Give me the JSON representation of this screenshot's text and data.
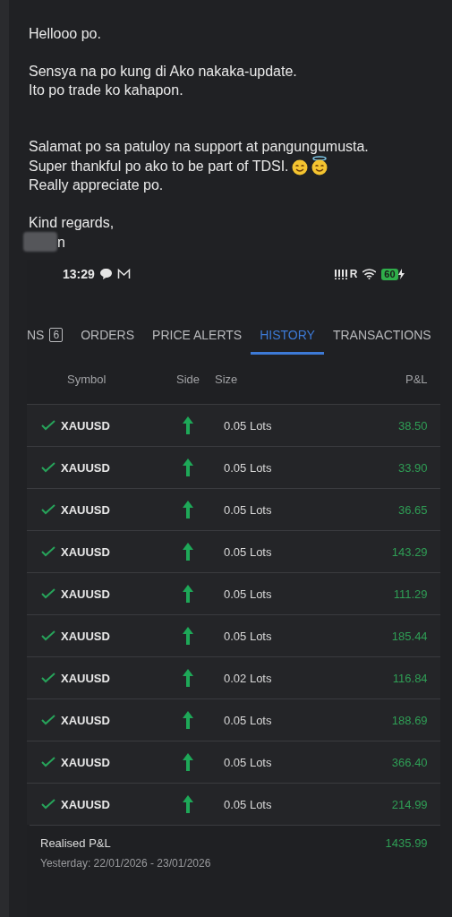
{
  "message": {
    "paragraphs": [
      [
        "Hellooo po."
      ],
      [
        "Sensya na po kung di Ako nakaka-update.",
        "Ito po trade ko kahapon."
      ],
      [
        "Salamat po sa patuloy na support at pangungumusta.",
        "Super thankful po ako to be part of TDSI.",
        "Really appreciate po."
      ],
      [
        "Kind regards,"
      ]
    ],
    "signature": "n"
  },
  "screenshot": {
    "status_bar": {
      "time": "13:29",
      "network": "R",
      "battery": "60"
    },
    "tabs": [
      {
        "label": "NS",
        "badge": "6",
        "selected": false
      },
      {
        "label": "ORDERS",
        "selected": false
      },
      {
        "label": "PRICE ALERTS",
        "selected": false
      },
      {
        "label": "HISTORY",
        "selected": true
      },
      {
        "label": "TRANSACTIONS",
        "selected": false
      }
    ],
    "table": {
      "columns": [
        "Symbol",
        "Side",
        "Size",
        "P&L"
      ],
      "rows": [
        {
          "symbol": "XAUUSD",
          "kind": "buy",
          "size": "0.05 Lots",
          "pnl": "38.50"
        },
        {
          "symbol": "XAUUSD",
          "kind": "buy",
          "size": "0.05 Lots",
          "pnl": "33.90"
        },
        {
          "symbol": "XAUUSD",
          "kind": "buy",
          "size": "0.05 Lots",
          "pnl": "36.65"
        },
        {
          "symbol": "XAUUSD",
          "kind": "buy",
          "size": "0.05 Lots",
          "pnl": "143.29"
        },
        {
          "symbol": "XAUUSD",
          "kind": "buy",
          "size": "0.05 Lots",
          "pnl": "111.29"
        },
        {
          "symbol": "XAUUSD",
          "kind": "buy",
          "size": "0.05 Lots",
          "pnl": "185.44"
        },
        {
          "symbol": "XAUUSD",
          "kind": "buy",
          "size": "0.02 Lots",
          "pnl": "116.84"
        },
        {
          "symbol": "XAUUSD",
          "kind": "buy",
          "size": "0.05 Lots",
          "pnl": "188.69"
        },
        {
          "symbol": "XAUUSD",
          "kind": "buy",
          "size": "0.05 Lots",
          "pnl": "366.40"
        },
        {
          "symbol": "XAUUSD",
          "kind": "buy",
          "size": "0.05 Lots",
          "pnl": "214.99"
        }
      ]
    },
    "summary": {
      "label": "Realised P&L",
      "range": "Yesterday: 22/01/2026 - 23/01/2026",
      "total": "1435.99"
    }
  }
}
